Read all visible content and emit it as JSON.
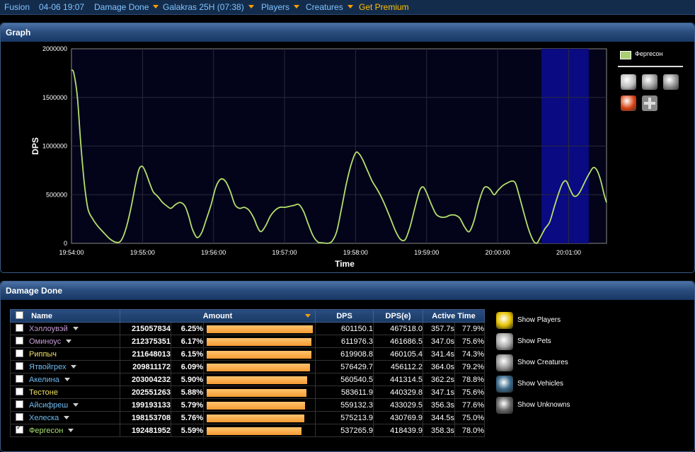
{
  "nav": {
    "items": [
      {
        "label": "Fusion",
        "caret": false
      },
      {
        "label": "04-06 19:07",
        "caret": false
      },
      {
        "label": "Damage Done",
        "caret": true
      },
      {
        "label": "Galakras 25H (07:38)",
        "caret": true
      },
      {
        "label": "Players",
        "caret": true
      },
      {
        "label": "Creatures",
        "caret": true
      },
      {
        "label": "Get Premium",
        "caret": false
      }
    ]
  },
  "graph_panel": {
    "title": "Graph"
  },
  "chart_data": {
    "type": "line",
    "ylabel": "DPS",
    "xlabel": "Time",
    "ylim": [
      0,
      2000000
    ],
    "yticks": [
      0,
      500000,
      1000000,
      1500000,
      2000000
    ],
    "xticks": [
      "19:54:00",
      "19:55:00",
      "19:56:00",
      "19:57:00",
      "19:58:00",
      "19:59:00",
      "20:00:00",
      "20:01:00"
    ],
    "x_unit": "seconds after 19:54:00",
    "xlim": [
      0,
      452
    ],
    "grid": true,
    "highlight_range": [
      397,
      437
    ],
    "series": [
      {
        "name": "Фергесон",
        "color": "#b5e06a",
        "points": [
          [
            0,
            1780000
          ],
          [
            2,
            1750000
          ],
          [
            5,
            1500000
          ],
          [
            8,
            1000000
          ],
          [
            11,
            600000
          ],
          [
            14,
            350000
          ],
          [
            18,
            250000
          ],
          [
            22,
            180000
          ],
          [
            28,
            100000
          ],
          [
            33,
            40000
          ],
          [
            38,
            10000
          ],
          [
            42,
            30000
          ],
          [
            46,
            150000
          ],
          [
            50,
            350000
          ],
          [
            54,
            600000
          ],
          [
            57,
            760000
          ],
          [
            60,
            790000
          ],
          [
            63,
            720000
          ],
          [
            66,
            620000
          ],
          [
            69,
            530000
          ],
          [
            73,
            480000
          ],
          [
            77,
            420000
          ],
          [
            81,
            380000
          ],
          [
            84,
            360000
          ],
          [
            88,
            400000
          ],
          [
            92,
            420000
          ],
          [
            96,
            380000
          ],
          [
            99,
            280000
          ],
          [
            102,
            150000
          ],
          [
            106,
            60000
          ],
          [
            110,
            110000
          ],
          [
            114,
            250000
          ],
          [
            118,
            400000
          ],
          [
            122,
            580000
          ],
          [
            126,
            660000
          ],
          [
            130,
            640000
          ],
          [
            134,
            540000
          ],
          [
            138,
            400000
          ],
          [
            142,
            360000
          ],
          [
            146,
            370000
          ],
          [
            150,
            340000
          ],
          [
            154,
            260000
          ],
          [
            157,
            170000
          ],
          [
            160,
            120000
          ],
          [
            164,
            180000
          ],
          [
            168,
            280000
          ],
          [
            172,
            340000
          ],
          [
            176,
            370000
          ],
          [
            180,
            370000
          ],
          [
            184,
            380000
          ],
          [
            188,
            390000
          ],
          [
            192,
            400000
          ],
          [
            196,
            330000
          ],
          [
            200,
            200000
          ],
          [
            204,
            80000
          ],
          [
            208,
            15000
          ],
          [
            212,
            5000
          ],
          [
            216,
            0
          ],
          [
            220,
            20000
          ],
          [
            224,
            120000
          ],
          [
            228,
            350000
          ],
          [
            232,
            600000
          ],
          [
            236,
            800000
          ],
          [
            240,
            930000
          ],
          [
            243,
            920000
          ],
          [
            246,
            860000
          ],
          [
            250,
            750000
          ],
          [
            254,
            640000
          ],
          [
            258,
            560000
          ],
          [
            262,
            470000
          ],
          [
            266,
            360000
          ],
          [
            270,
            240000
          ],
          [
            274,
            120000
          ],
          [
            278,
            40000
          ],
          [
            282,
            40000
          ],
          [
            286,
            170000
          ],
          [
            290,
            360000
          ],
          [
            294,
            540000
          ],
          [
            297,
            580000
          ],
          [
            300,
            520000
          ],
          [
            304,
            400000
          ],
          [
            308,
            300000
          ],
          [
            312,
            270000
          ],
          [
            316,
            270000
          ],
          [
            320,
            290000
          ],
          [
            324,
            290000
          ],
          [
            328,
            260000
          ],
          [
            332,
            170000
          ],
          [
            336,
            120000
          ],
          [
            340,
            230000
          ],
          [
            344,
            420000
          ],
          [
            348,
            560000
          ],
          [
            351,
            580000
          ],
          [
            354,
            550000
          ],
          [
            357,
            500000
          ],
          [
            360,
            540000
          ],
          [
            364,
            590000
          ],
          [
            368,
            620000
          ],
          [
            372,
            640000
          ],
          [
            375,
            620000
          ],
          [
            378,
            500000
          ],
          [
            382,
            320000
          ],
          [
            386,
            150000
          ],
          [
            390,
            30000
          ],
          [
            393,
            0
          ],
          [
            396,
            60000
          ],
          [
            400,
            150000
          ],
          [
            404,
            220000
          ],
          [
            408,
            380000
          ],
          [
            412,
            530000
          ],
          [
            415,
            620000
          ],
          [
            418,
            640000
          ],
          [
            421,
            560000
          ],
          [
            424,
            490000
          ],
          [
            427,
            490000
          ],
          [
            430,
            540000
          ],
          [
            434,
            640000
          ],
          [
            438,
            730000
          ],
          [
            441,
            780000
          ],
          [
            444,
            750000
          ],
          [
            447,
            650000
          ],
          [
            450,
            500000
          ],
          [
            452,
            420000
          ]
        ]
      }
    ]
  },
  "legend": {
    "label": "Фергесон",
    "color": "#a8d070"
  },
  "damage_panel": {
    "title": "Damage Done"
  },
  "table": {
    "headers": {
      "name": "Name",
      "amount": "Amount",
      "dps": "DPS",
      "dpse": "DPS(e)",
      "active": "Active Time"
    },
    "max_amount": 215057834,
    "rows": [
      {
        "name": "Хэллоувэй",
        "class": "purple",
        "caret": true,
        "checked": false,
        "amount": "215057834",
        "amount_value": 215057834,
        "pct": "6.25%",
        "dps": "601150.1",
        "dpse": "467518.0",
        "time": "357.7s",
        "time_pct": "77.9%"
      },
      {
        "name": "Оминоус",
        "class": "purple",
        "caret": true,
        "checked": false,
        "amount": "212375351",
        "amount_value": 212375351,
        "pct": "6.17%",
        "dps": "611976.3",
        "dpse": "461686.5",
        "time": "347.0s",
        "time_pct": "75.6%"
      },
      {
        "name": "Риппыч",
        "class": "yellow",
        "caret": false,
        "checked": false,
        "amount": "211648013",
        "amount_value": 211648013,
        "pct": "6.15%",
        "dps": "619908.8",
        "dpse": "460105.4",
        "time": "341.4s",
        "time_pct": "74.3%"
      },
      {
        "name": "Ятвойгрех",
        "class": "blue",
        "caret": true,
        "checked": false,
        "amount": "209811172",
        "amount_value": 209811172,
        "pct": "6.09%",
        "dps": "576429.7",
        "dpse": "456112.2",
        "time": "364.0s",
        "time_pct": "79.2%"
      },
      {
        "name": "Акелина",
        "class": "blue",
        "caret": true,
        "checked": false,
        "amount": "203004232",
        "amount_value": 203004232,
        "pct": "5.90%",
        "dps": "560540.5",
        "dpse": "441314.5",
        "time": "362.2s",
        "time_pct": "78.8%"
      },
      {
        "name": "Тестоне",
        "class": "yellow",
        "caret": false,
        "checked": false,
        "amount": "202551263",
        "amount_value": 202551263,
        "pct": "5.88%",
        "dps": "583611.9",
        "dpse": "440329.8",
        "time": "347.1s",
        "time_pct": "75.6%"
      },
      {
        "name": "Айсифреш",
        "class": "blue",
        "caret": true,
        "checked": false,
        "amount": "199193133",
        "amount_value": 199193133,
        "pct": "5.79%",
        "dps": "559132.3",
        "dpse": "433029.5",
        "time": "356.3s",
        "time_pct": "77.6%"
      },
      {
        "name": "Хелеска",
        "class": "blue",
        "caret": true,
        "checked": false,
        "amount": "198153708",
        "amount_value": 198153708,
        "pct": "5.76%",
        "dps": "575213.9",
        "dpse": "430769.9",
        "time": "344.5s",
        "time_pct": "75.0%"
      },
      {
        "name": "Фергесон",
        "class": "green",
        "caret": true,
        "checked": true,
        "amount": "192481952",
        "amount_value": 192481952,
        "pct": "5.59%",
        "dps": "537265.9",
        "dpse": "418439.9",
        "time": "358.3s",
        "time_pct": "78.0%"
      }
    ]
  },
  "show_list": [
    {
      "label": "Show Players",
      "icon": "players-icon",
      "color": "#e6c200"
    },
    {
      "label": "Show Pets",
      "icon": "pets-icon",
      "color": "#aaaaaa"
    },
    {
      "label": "Show Creatures",
      "icon": "creatures-icon",
      "color": "#9a9a9a"
    },
    {
      "label": "Show Vehicles",
      "icon": "vehicles-icon",
      "color": "#3a6a8a"
    },
    {
      "label": "Show Unknowns",
      "icon": "unknowns-icon",
      "color": "#666666"
    }
  ],
  "filters": [
    {
      "icon": "pets-filter-icon",
      "color": "#bbbbbb"
    },
    {
      "icon": "skull-filter-icon",
      "color": "#999999"
    },
    {
      "icon": "creature-filter-icon",
      "color": "#8a8a8a"
    },
    {
      "icon": "fire-filter-icon",
      "color": "#d84010"
    },
    {
      "icon": "add-filter-icon",
      "color": "#888888"
    }
  ]
}
